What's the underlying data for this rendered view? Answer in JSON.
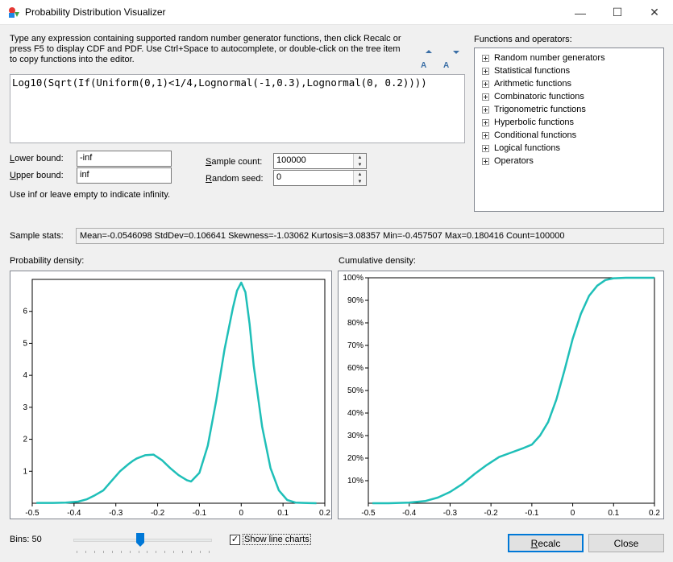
{
  "window": {
    "title": "Probability Distribution Visualizer",
    "controls": {
      "minimize": "—",
      "maximize": "☐",
      "close": "✕"
    }
  },
  "instructions": "Type any expression containing supported random number generator functions, then click Recalc or press F5 to display CDF and PDF. Use Ctrl+Space to autocomplete, or double-click on the tree item to copy functions into the editor.",
  "font_controls": {
    "increase": "A",
    "decrease": "A"
  },
  "editor": {
    "expression": "Log10(Sqrt(If(Uniform(0,1)<1/4,Lognormal(-1,0.3),Lognormal(0, 0.2))))"
  },
  "functions": {
    "label": "Functions and operators:",
    "items": [
      "Random number generators",
      "Statistical functions",
      "Arithmetic functions",
      "Combinatoric functions",
      "Trigonometric functions",
      "Hyperbolic functions",
      "Conditional functions",
      "Logical functions",
      "Operators"
    ]
  },
  "bounds": {
    "lower_label_key": "L",
    "lower_label_rest": "ower bound:",
    "lower_value": "-inf",
    "upper_label_key": "U",
    "upper_label_rest": "pper bound:",
    "upper_value": "inf",
    "hint": "Use inf or leave empty to indicate infinity."
  },
  "sampling": {
    "count_label_key": "S",
    "count_label_rest": "ample count:",
    "count_value": "100000",
    "seed_label_key": "R",
    "seed_label_rest": "andom seed:",
    "seed_value": "0"
  },
  "stats": {
    "label": "Sample stats:",
    "text": "Mean=-0.0546098  StdDev=0.106641  Skewness=-1.03062  Kurtosis=3.08357  Min=-0.457507  Max=0.180416  Count=100000"
  },
  "pdf_label": "Probability density:",
  "cdf_label": "Cumulative density:",
  "bins": {
    "label": "Bins:",
    "value": "50",
    "slider_fraction": 0.48
  },
  "show_line_charts": {
    "label": "Show line charts",
    "checked": true,
    "mark": "✓"
  },
  "buttons": {
    "recalc_key": "R",
    "recalc_rest": "ecalc",
    "close": "Close"
  },
  "colors": {
    "line": "#1fbfb8",
    "accent": "#0078d7"
  },
  "chart_data": [
    {
      "type": "line",
      "xlim": [
        -0.5,
        0.2
      ],
      "ylim": [
        0,
        7
      ],
      "xticks": [
        "-0.5",
        "-0.4",
        "-0.3",
        "-0.2",
        "-0.1",
        "0",
        "0.1",
        "0.2"
      ],
      "yticks": [
        "1",
        "2",
        "3",
        "4",
        "5",
        "6"
      ],
      "series": [
        {
          "x": [
            -0.49,
            -0.45,
            -0.42,
            -0.39,
            -0.37,
            -0.35,
            -0.33,
            -0.31,
            -0.29,
            -0.27,
            -0.26,
            -0.25,
            -0.23,
            -0.21,
            -0.19,
            -0.17,
            -0.15,
            -0.13,
            -0.12,
            -0.1,
            -0.08,
            -0.06,
            -0.04,
            -0.02,
            -0.01,
            0.0,
            0.01,
            0.02,
            0.03,
            0.05,
            0.07,
            0.09,
            0.11,
            0.13,
            0.15,
            0.18
          ],
          "y": [
            0.01,
            0.01,
            0.02,
            0.05,
            0.12,
            0.25,
            0.4,
            0.7,
            1.0,
            1.22,
            1.32,
            1.4,
            1.5,
            1.52,
            1.35,
            1.1,
            0.88,
            0.72,
            0.68,
            0.95,
            1.8,
            3.2,
            4.8,
            6.1,
            6.65,
            6.9,
            6.6,
            5.6,
            4.3,
            2.4,
            1.1,
            0.4,
            0.1,
            0.02,
            0.01,
            0.0
          ]
        }
      ]
    },
    {
      "type": "line",
      "xlim": [
        -0.5,
        0.2
      ],
      "ylim": [
        0,
        1
      ],
      "xticks": [
        "-0.5",
        "-0.4",
        "-0.3",
        "-0.2",
        "-0.1",
        "0",
        "0.1",
        "0.2"
      ],
      "yticks": [
        "10%",
        "20%",
        "30%",
        "40%",
        "50%",
        "60%",
        "70%",
        "80%",
        "90%",
        "100%"
      ],
      "series": [
        {
          "x": [
            -0.49,
            -0.45,
            -0.4,
            -0.36,
            -0.33,
            -0.3,
            -0.27,
            -0.24,
            -0.21,
            -0.18,
            -0.15,
            -0.12,
            -0.1,
            -0.08,
            -0.06,
            -0.04,
            -0.02,
            0.0,
            0.02,
            0.04,
            0.06,
            0.08,
            0.1,
            0.13,
            0.16,
            0.2
          ],
          "y": [
            0.0,
            0.0,
            0.003,
            0.01,
            0.025,
            0.05,
            0.085,
            0.13,
            0.17,
            0.205,
            0.225,
            0.245,
            0.26,
            0.3,
            0.36,
            0.46,
            0.59,
            0.73,
            0.84,
            0.92,
            0.965,
            0.99,
            0.998,
            1.0,
            1.0,
            1.0
          ]
        }
      ]
    }
  ]
}
